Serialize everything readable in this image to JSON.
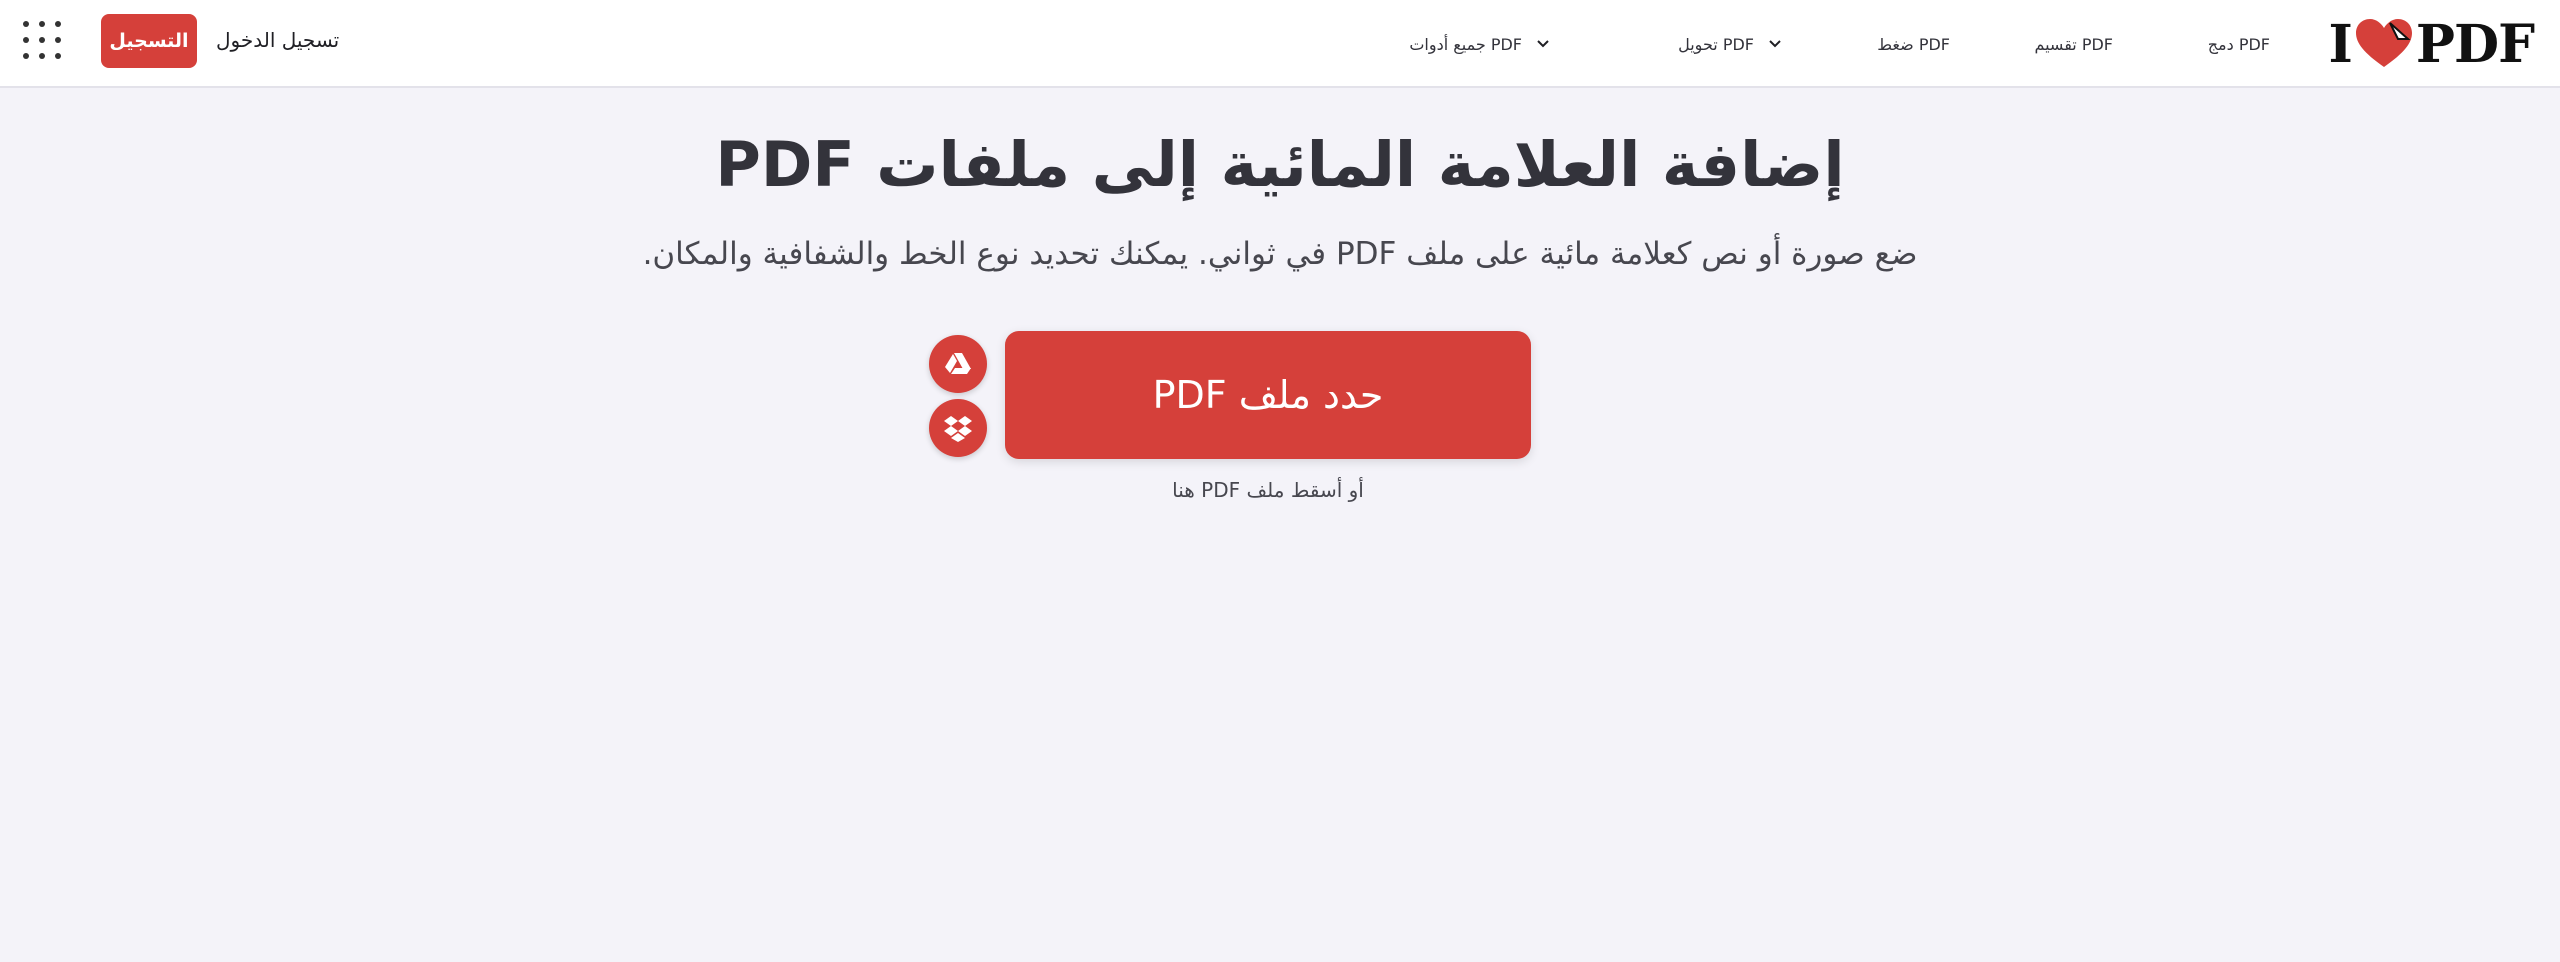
{
  "header": {
    "logo": {
      "prefix": "I",
      "suffix": "PDF"
    },
    "nav": [
      {
        "label": "دمج PDF",
        "has_dropdown": false
      },
      {
        "label": "تقسيم PDF",
        "has_dropdown": false
      },
      {
        "label": "ضغط PDF",
        "has_dropdown": false
      },
      {
        "label": "تحويل PDF",
        "has_dropdown": true
      },
      {
        "label": "جميع أدوات PDF",
        "has_dropdown": true
      }
    ],
    "login_label": "تسجيل الدخول",
    "signup_label": "التسجيل",
    "apps_icon": "grid-dots-icon"
  },
  "main": {
    "title": "إضافة العلامة المائية إلى ملفات PDF",
    "subtitle": "ضع صورة أو نص كعلامة مائية على ملف PDF في ثواني. يمكنك تحديد نوع الخط والشفافية والمكان.",
    "select_button_label": "حدد ملف PDF",
    "drop_hint": "أو أسقط ملف PDF هنا",
    "cloud_sources": [
      {
        "name": "google-drive-icon"
      },
      {
        "name": "dropbox-icon"
      }
    ]
  },
  "colors": {
    "accent": "#d5403a",
    "background": "#f4f3f9",
    "header_bg": "#ffffff",
    "text": "#33333b"
  }
}
